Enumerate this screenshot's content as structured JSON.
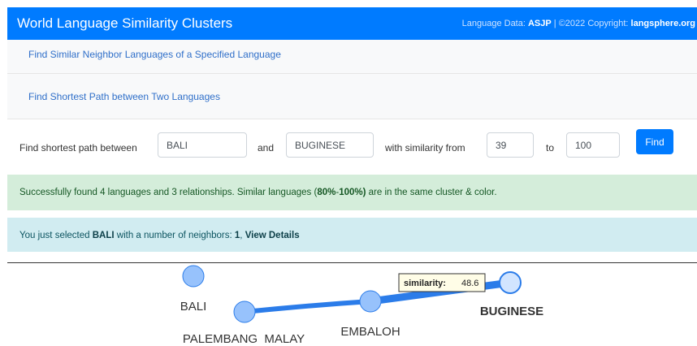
{
  "navbar": {
    "title": "World Language Similarity Clusters",
    "credits_prefix": "Language Data: ",
    "credits_source": "ASJP",
    "credits_mid": " | ©2022 Copyright: ",
    "credits_site": "langsphere.org"
  },
  "menu": {
    "similar_link": "Find Similar Neighbor Languages of a Specified Language",
    "path_link": "Find Shortest Path between Two Languages"
  },
  "form": {
    "label_between": "Find shortest path between",
    "from_lang": "BALI",
    "label_and": "and",
    "to_lang": "BUGINESE",
    "label_similarity": "with similarity from",
    "sim_from": "39",
    "label_to": "to",
    "sim_to": "100",
    "find_button": "Find"
  },
  "success_alert": {
    "prefix": "Successfully found 4 languages and 3 relationships. Similar languages (",
    "range_low": "80%",
    "range_sep": "-",
    "range_high": "100%)",
    "suffix": " are in the same cluster & color."
  },
  "info_alert": {
    "prefix": "You just selected ",
    "language": "BALI",
    "mid": " with a number of neighbors: ",
    "neighbors": "1",
    "sep": ", ",
    "details_link": "View Details"
  },
  "graph": {
    "nodes": {
      "bali": "BALI",
      "palembang": "PALEMBANG  MALAY",
      "embaloh": "EMBALOH",
      "buginese": "BUGINESE"
    },
    "tooltip": {
      "label": "similarity:",
      "value": "48.6"
    },
    "colors": {
      "node_fill": "#97c2fc",
      "node_stroke": "#2b7ce9",
      "edge": "#2b7ce9"
    }
  }
}
